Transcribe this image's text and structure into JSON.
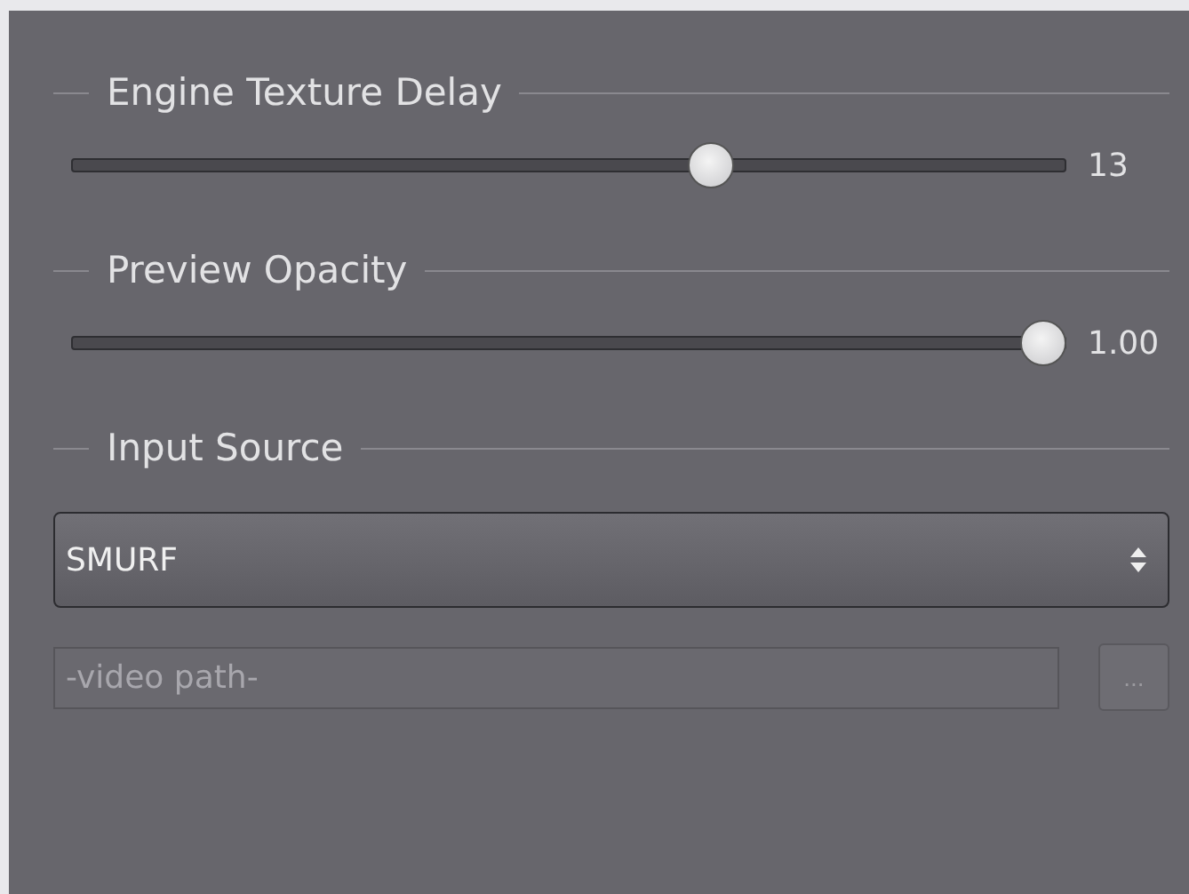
{
  "groups": [
    {
      "title": "Engine Texture Delay",
      "kind": "slider",
      "level": 0.65,
      "reading": "13"
    },
    {
      "title": "Preview Opacity",
      "kind": "slider",
      "level": 1.0,
      "reading": "1.00"
    },
    {
      "title": "Input Source",
      "kind": "source",
      "value": "SMURF",
      "path": {
        "placeholder": "-video path-",
        "disabled": true
      },
      "browse": {
        "label": "...",
        "disabled": true
      }
    }
  ]
}
